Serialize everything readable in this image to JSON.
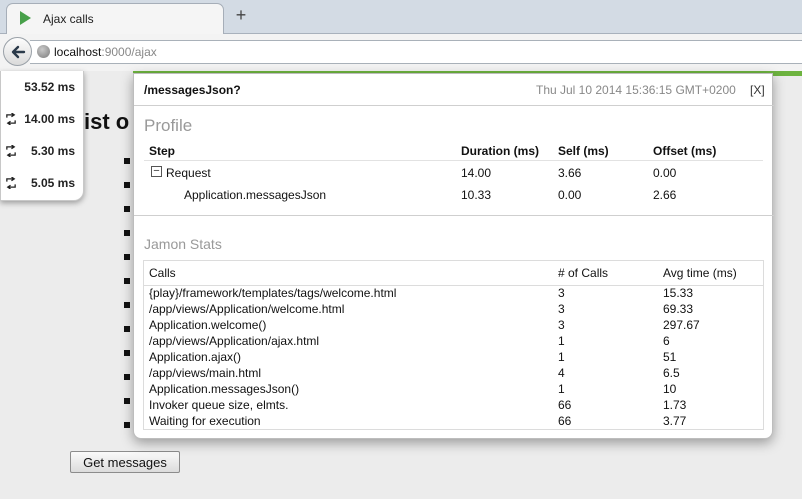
{
  "browser": {
    "tab_title": "Ajax calls",
    "new_tab_symbol": "+",
    "url_host": "localhost",
    "url_path": ":9000/ajax",
    "favicon": "play-icon",
    "back_icon": "back-arrow-icon",
    "site_icon": "globe-icon"
  },
  "page": {
    "heading_visible": "ist o",
    "bullet_count": 12,
    "get_messages_label": "Get messages"
  },
  "profiler_results": [
    {
      "time": "53.52 ms",
      "ajax": false
    },
    {
      "time": "14.00 ms",
      "ajax": true
    },
    {
      "time": "5.30 ms",
      "ajax": true
    },
    {
      "time": "5.05 ms",
      "ajax": true
    }
  ],
  "popup": {
    "name": "/messagesJson?",
    "date": "Thu Jul 10 2014 15:36:15 GMT+0200",
    "close_label": "[X]",
    "profile_title": "Profile",
    "profile_headers": {
      "step": "Step",
      "duration": "Duration (ms)",
      "self": "Self (ms)",
      "offset": "Offset (ms)"
    },
    "toggle_symbol": "−",
    "profile_rows": [
      {
        "step": "Request",
        "duration": "14.00",
        "self": "3.66",
        "offset": "0.00"
      },
      {
        "step": "Application.messagesJson",
        "duration": "10.33",
        "self": "0.00",
        "offset": "2.66"
      }
    ],
    "jamon_title": "Jamon Stats",
    "jamon_headers": {
      "calls": "Calls",
      "count": "# of Calls",
      "avg": "Avg time (ms)"
    },
    "jamon_rows": [
      {
        "call": "{play}/framework/templates/tags/welcome.html",
        "count": "3",
        "avg": "15.33"
      },
      {
        "call": "/app/views/Application/welcome.html",
        "count": "3",
        "avg": "69.33"
      },
      {
        "call": "Application.welcome()",
        "count": "3",
        "avg": "297.67"
      },
      {
        "call": "/app/views/Application/ajax.html",
        "count": "1",
        "avg": "6"
      },
      {
        "call": "Application.ajax()",
        "count": "1",
        "avg": "51"
      },
      {
        "call": "/app/views/main.html",
        "count": "4",
        "avg": "6.5"
      },
      {
        "call": "Application.messagesJson()",
        "count": "1",
        "avg": "10"
      },
      {
        "call": "Invoker queue size, elmts.",
        "count": "66",
        "avg": "1.73"
      },
      {
        "call": "Waiting for execution",
        "count": "66",
        "avg": "3.77"
      }
    ]
  },
  "colors": {
    "accent_green": "#6db33f",
    "muted_title": "#999999"
  }
}
